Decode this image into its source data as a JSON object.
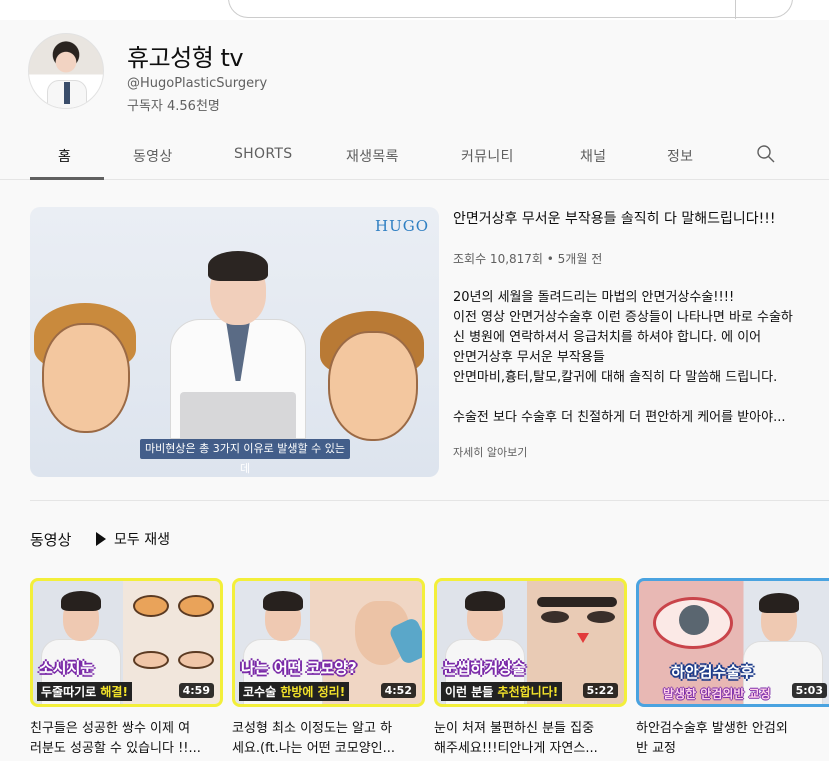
{
  "channel": {
    "name": "휴고성형 tv",
    "handle": "@HugoPlasticSurgery",
    "subscribers": "구독자 4.56천명"
  },
  "tabs": [
    {
      "label": "홈",
      "active": true
    },
    {
      "label": "동영상",
      "active": false
    },
    {
      "label": "SHORTS",
      "active": false
    },
    {
      "label": "재생목록",
      "active": false
    },
    {
      "label": "커뮤니티",
      "active": false
    },
    {
      "label": "채널",
      "active": false
    },
    {
      "label": "정보",
      "active": false
    }
  ],
  "featured": {
    "logo": "HUGO",
    "caption": "마비현상은 총 3가지 이유로 발생할 수 있는데",
    "title": "안면거상후 무서운 부작용들 솔직히 다 말해드립니다!!!",
    "meta": "조회수 10,817회 • 5개월 전",
    "description": [
      "20년의 세월을 돌려드리는 마법의 안면거상수술!!!!",
      "이전 영상 안면거상수술후 이런 증상들이 나타나면 바로 수술하",
      "신 병원에 연락하셔서 응급처치를 하셔야 합니다. 에 이어",
      "안면거상후 무서운 부작용들",
      "안면마비,흉터,탈모,칼귀에 대해 솔직히 다 말씀해 드립니다.",
      "",
      "수술전 보다 수술후 더 친절하게 더 편안하게 케어를 받아야..."
    ],
    "more": "자세히 알아보기"
  },
  "shelf": {
    "title": "동영상",
    "play_all": "모두 재생",
    "videos": [
      {
        "overlay_top": "소시지눈",
        "overlay_bottom_pre": "두줄따기로 ",
        "overlay_bottom_hl": "해결!",
        "duration": "4:59",
        "title_1": "친구들은 성공한 쌍수 이제 여",
        "title_2": "러분도 성공할 수 있습니다 !!..."
      },
      {
        "overlay_top": "나는 어떤 코모양?",
        "overlay_bottom_pre": "코수술 ",
        "overlay_bottom_hl": "한방에 정리!",
        "duration": "4:52",
        "title_1": "코성형 최소 이정도는 알고 하",
        "title_2": "세요.(ft.나는 어떤 코모양인..."
      },
      {
        "overlay_top": "눈썹하거상술",
        "overlay_bottom_pre": "이런 분들 ",
        "overlay_bottom_hl": "추천합니다!",
        "duration": "5:22",
        "title_1": "눈이 처져 불편하신 분들 집중",
        "title_2": "해주세요!!!티안나게 자연스..."
      },
      {
        "overlay_top": "하안검수술후",
        "overlay_bottom_pre": "",
        "overlay_bottom_hl": "발생한 안검외반 교정",
        "duration": "5:03",
        "title_1": "하안검수술후 발생한 안검외",
        "title_2": "반 교정"
      }
    ]
  },
  "colors": {
    "accent_purple": "#7a2aa8",
    "highlight_yellow": "#f2e22a",
    "thumb_border_yellow": "#f3ef3a",
    "thumb_border_blue": "#4aa3e0"
  }
}
